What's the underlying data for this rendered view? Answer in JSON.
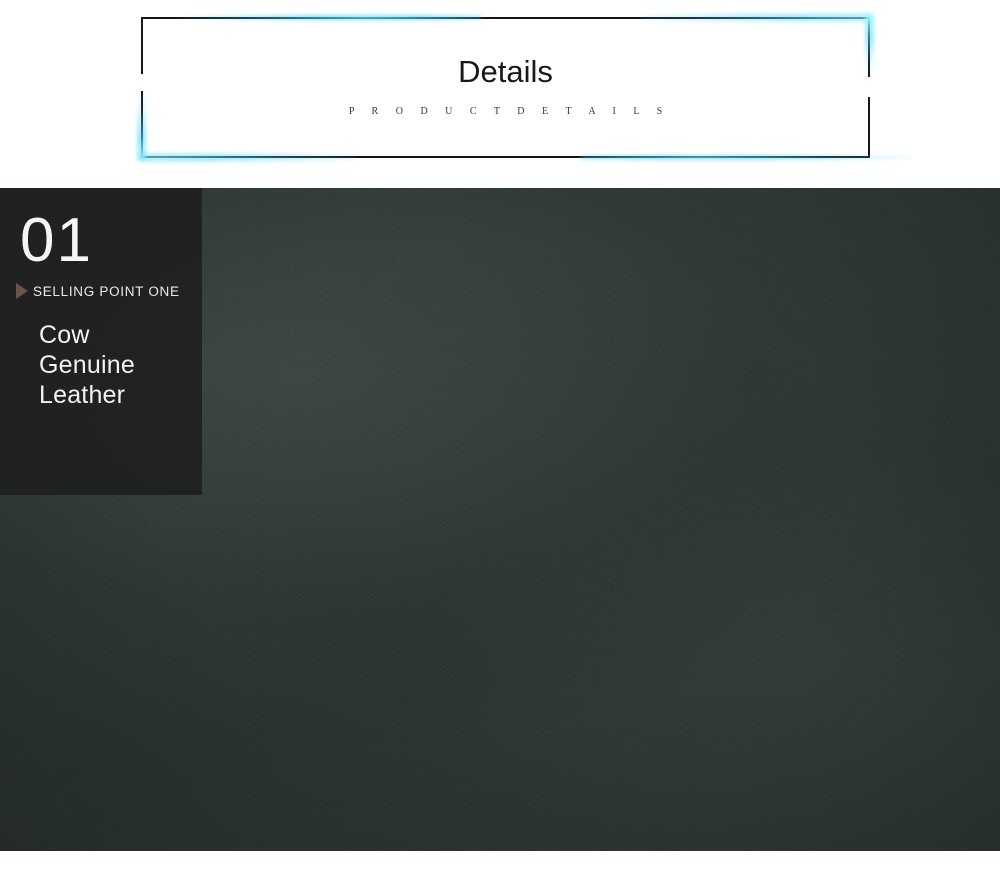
{
  "header": {
    "title": "Details",
    "subtitle": "P R O D U C T   D E T A I L S",
    "frame_border_color": "#17171a",
    "glow_color": "#5de0f6",
    "background": "#ffffff"
  },
  "selling_point": {
    "number": "01",
    "tag_icon": "play-triangle-icon",
    "tag_label": "SELLING POINT ONE",
    "headline_lines": [
      "Cow",
      "Genuine",
      "Leather"
    ],
    "panel_color": "#1f2022",
    "number_color": "#f4f5f6",
    "triangle_color": "#6a5545"
  },
  "product_image": {
    "alt": "close-up of dark green cow genuine leather texture",
    "base_color": "#2e3734",
    "highlight_color": "#3a4541",
    "shadow_color": "#252d2a"
  },
  "footer": {
    "background": "#ffffff"
  }
}
